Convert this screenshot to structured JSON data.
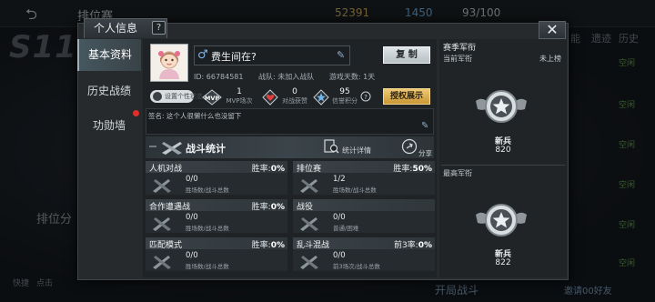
{
  "background": {
    "top_texts": [
      "排位赛",
      "?",
      "52391",
      "1450",
      "93/100",
      "+"
    ],
    "season_logo": "S11",
    "left_labels": [
      "排位分",
      "快捷",
      "点击"
    ],
    "right_tabs": [
      "能",
      "遗迹",
      "历史"
    ],
    "right_items": [
      "空闲",
      "空闲",
      "空闲",
      "空闲",
      "空闲",
      "空闲"
    ],
    "bottom_texts": [
      "开局战斗",
      "邀请00好友"
    ]
  },
  "dialog": {
    "title": "个人信息",
    "help": "?",
    "close": "✕"
  },
  "side_tabs": [
    "基本资料",
    "历史战绩",
    "功勋墙"
  ],
  "profile": {
    "gender_symbol": "♂",
    "nickname": "费生间在?",
    "id_label": "ID: 66784581",
    "team_label": "战队: 未加入战队",
    "days_label": "游戏天数: 1天",
    "copy_button": "复  制",
    "status_button": "设置个性状态",
    "mvp_value": "1",
    "mvp_label": "MVP场次",
    "trophy_value": "0",
    "trophy_label": "对战获赞",
    "credit_value": "95",
    "credit_label": "信誉积分",
    "showcase_button": "授权展示",
    "signature": "签名: 这个人很懒什么也没留下"
  },
  "battle": {
    "title": "战斗统计",
    "detail_label": "统计详情",
    "share_label": "分享"
  },
  "modes": [
    {
      "name": "人机对战",
      "rate_label": "胜率:",
      "rate": "0%",
      "value": "0/0",
      "sub": "胜场数/战斗总数"
    },
    {
      "name": "排位赛",
      "rate_label": "胜率:",
      "rate": "50%",
      "value": "1/2",
      "sub": "胜场数/战斗总数"
    },
    {
      "name": "合作遭遇战",
      "rate_label": "胜率:",
      "rate": "0%",
      "value": "0/0",
      "sub": "胜场数/战斗总数"
    },
    {
      "name": "战役",
      "rate_label": "",
      "rate": "",
      "value": "0/0",
      "sub": "普通/困难"
    },
    {
      "name": "匹配模式",
      "rate_label": "胜率:",
      "rate": "0%",
      "value": "0/0",
      "sub": "胜场数/战斗总数"
    },
    {
      "name": "乱斗混战",
      "rate_label": "前3率:",
      "rate": "0%",
      "value": "0/0",
      "sub": "前3场次/战斗总数"
    }
  ],
  "rank": {
    "section_title": "赛季军衔",
    "current_label": "当前军衔",
    "current_status": "未上榜",
    "current_name": "新兵",
    "current_score": "820",
    "highest_label": "最高军衔",
    "highest_name": "新兵",
    "highest_score": "822"
  },
  "colors": {
    "gold_button": "#e0b55a",
    "silver_button": "#cdd4d8",
    "accent_blue": "#7fb4e6",
    "notify_red": "#e0302c"
  }
}
